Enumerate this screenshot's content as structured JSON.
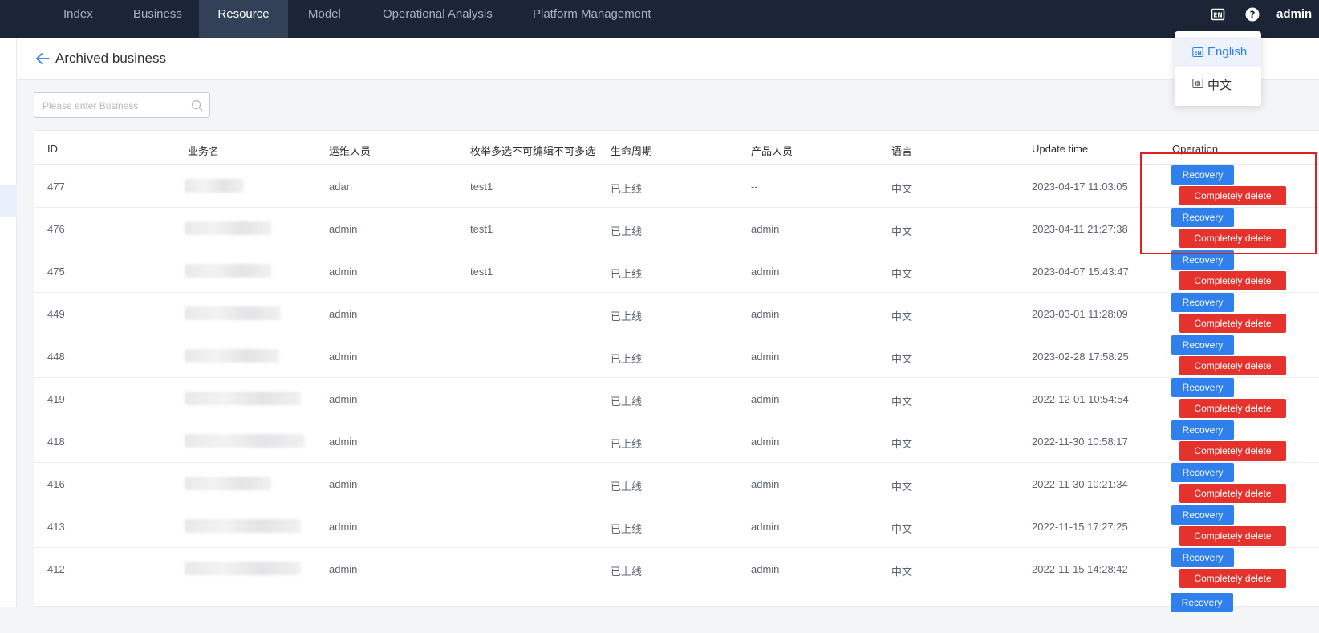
{
  "nav": {
    "items": [
      "Index",
      "Business",
      "Resource",
      "Model",
      "Operational Analysis",
      "Platform Management"
    ],
    "active": "Resource",
    "user": "admin"
  },
  "header": {
    "title": "Archived business"
  },
  "search": {
    "placeholder": "Please enter Business"
  },
  "language_menu": {
    "items": [
      "English",
      "中文"
    ],
    "selected": "English"
  },
  "table": {
    "columns": [
      "ID",
      "业务名",
      "运维人员",
      "枚举多选不可编辑不可多选",
      "生命周期",
      "产品人员",
      "语言",
      "Update time",
      "Operation"
    ],
    "rows": [
      {
        "id": "477",
        "ops": "adan",
        "enum": "test1",
        "lifecycle": "已上线",
        "product": "--",
        "lang": "中文",
        "updated": "2023-04-17 11:03:05"
      },
      {
        "id": "476",
        "ops": "admin",
        "enum": "test1",
        "lifecycle": "已上线",
        "product": "admin",
        "lang": "中文",
        "updated": "2023-04-11 21:27:38"
      },
      {
        "id": "475",
        "ops": "admin",
        "enum": "test1",
        "lifecycle": "已上线",
        "product": "admin",
        "lang": "中文",
        "updated": "2023-04-07 15:43:47"
      },
      {
        "id": "449",
        "ops": "admin",
        "enum": "",
        "lifecycle": "已上线",
        "product": "admin",
        "lang": "中文",
        "updated": "2023-03-01 11:28:09"
      },
      {
        "id": "448",
        "ops": "admin",
        "enum": "",
        "lifecycle": "已上线",
        "product": "admin",
        "lang": "中文",
        "updated": "2023-02-28 17:58:25"
      },
      {
        "id": "419",
        "ops": "admin",
        "enum": "",
        "lifecycle": "已上线",
        "product": "admin",
        "lang": "中文",
        "updated": "2022-12-01 10:54:54"
      },
      {
        "id": "418",
        "ops": "admin",
        "enum": "",
        "lifecycle": "已上线",
        "product": "admin",
        "lang": "中文",
        "updated": "2022-11-30 10:58:17"
      },
      {
        "id": "416",
        "ops": "admin",
        "enum": "",
        "lifecycle": "已上线",
        "product": "admin",
        "lang": "中文",
        "updated": "2022-11-30 10:21:34"
      },
      {
        "id": "413",
        "ops": "admin",
        "enum": "",
        "lifecycle": "已上线",
        "product": "admin",
        "lang": "中文",
        "updated": "2022-11-15 17:27:25"
      },
      {
        "id": "412",
        "ops": "admin",
        "enum": "",
        "lifecycle": "已上线",
        "product": "admin",
        "lang": "中文",
        "updated": "2022-11-15 14:28:42"
      }
    ],
    "actions": {
      "recovery": "Recovery",
      "delete": "Completely delete"
    }
  },
  "colors": {
    "nav_bg": "#1b2536",
    "primary": "#2f80ed",
    "danger": "#e5322d",
    "highlight": "#e02020"
  }
}
